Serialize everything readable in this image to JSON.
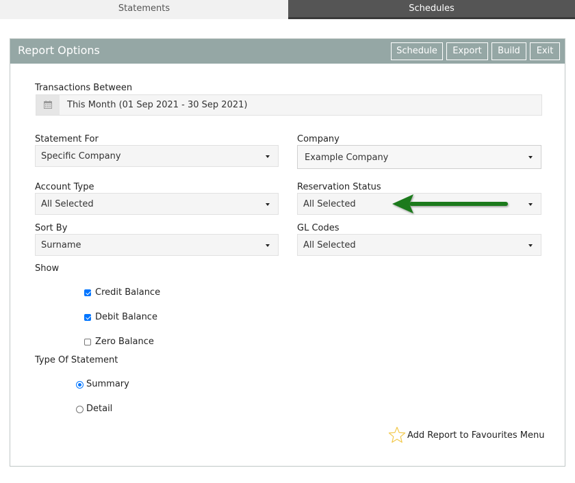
{
  "tabs": [
    {
      "label": "Statements",
      "active": false
    },
    {
      "label": "Schedules",
      "active": true
    }
  ],
  "panel": {
    "title": "Report Options",
    "buttons": {
      "schedule": "Schedule",
      "export": "Export",
      "build": "Build",
      "exit": "Exit"
    }
  },
  "transactions": {
    "label": "Transactions Between",
    "value": "This Month (01 Sep 2021 - 30 Sep 2021)",
    "icon": "calendar-icon"
  },
  "statement_for": {
    "label": "Statement For",
    "value": "Specific Company"
  },
  "company": {
    "label": "Company",
    "value": "Example Company"
  },
  "account_type": {
    "label": "Account Type",
    "value": "All Selected"
  },
  "reservation_status": {
    "label": "Reservation Status",
    "value": "All Selected"
  },
  "sort_by": {
    "label": "Sort By",
    "value": "Surname"
  },
  "gl_codes": {
    "label": "GL Codes",
    "value": "All Selected"
  },
  "show": {
    "label": "Show",
    "options": [
      {
        "label": "Credit Balance",
        "checked": true
      },
      {
        "label": "Debit Balance",
        "checked": true
      },
      {
        "label": "Zero Balance",
        "checked": false
      }
    ]
  },
  "statement_type": {
    "label": "Type Of Statement",
    "options": [
      {
        "label": "Summary",
        "selected": true
      },
      {
        "label": "Detail",
        "selected": false
      }
    ]
  },
  "favourites": {
    "label": "Add Report to Favourites Menu",
    "icon": "star-icon"
  },
  "colors": {
    "header": "#95a7a5",
    "active_tab": "#555555",
    "arrow": "#1f7a1f",
    "accent": "#0075ff"
  }
}
